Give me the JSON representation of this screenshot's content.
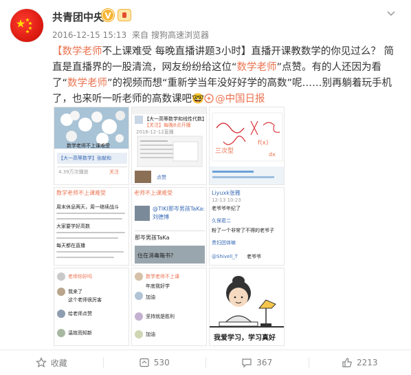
{
  "author": {
    "name": "共青团中央",
    "verified_mark": "V"
  },
  "meta": {
    "timestamp": "2016-12-15 15:13",
    "from": "来自",
    "source": "搜狗高速浏览器"
  },
  "post": {
    "p1_topic": "【数学老师",
    "p1_topic_rest": "不上课难受  每晚直播讲题3小时】",
    "p1_a": "直播开课教数学的你见过么？ 简直是直播界的一股清流，网友纷纷给这位“",
    "p1_hl1": "数学老师",
    "p1_b": "”点赞。有的人还因为看了“",
    "p1_hl2": "数学老师",
    "p1_c": "”的视频而想“重新学当年没好好学的高数”呢……别再躺着玩手机了，也来听一听老师的高数课吧",
    "emoji": "🤓",
    "link": "@中国日报"
  },
  "thumbs": {
    "t1": {
      "title": "数学老师不上课难受",
      "l1": "【大一高等数学】张献和",
      "l2": "4.39万次播放",
      "l3": "关注"
    },
    "t2": {
      "a": "【大一高等数学和线性代数】",
      "b": "【关注】每晚8点开播",
      "c": "2016-12-12直播",
      "d": "点赞"
    },
    "t3": {
      "a": "三次型",
      "b": "f(x)",
      "c": "dx"
    },
    "t4": {
      "title": "数学老师不上课难受",
      "a": "周末休息两天，周一继续战斗",
      "b": "大家要学好高数",
      "c": "每天都在直播"
    },
    "t5": {
      "title": "老师不上课难受",
      "a": "@TIKI那岑男孩TaKa: 住在酒",
      "b": "刘德博",
      "c": "那岑男孩TaKa",
      "d": "住在消毒箱书?"
    },
    "t6": {
      "title": "Liyuxk张雅",
      "a": "12-13 10:23",
      "b": "老爷爷年纪了",
      "c": "久保君二",
      "d": "粉了一个非常了不得的老爷子",
      "e": "贵妇团体嘛",
      "f": "@Shivell_T",
      "g": "老爷爷"
    },
    "t7": {
      "a": "老师你好吗",
      "b": "我来了",
      "c": "这个老师很厉害",
      "d": "给老师点赞",
      "e": "温故而知新"
    },
    "t8": {
      "a": "数学老师不上课",
      "b": "年底我好学",
      "c": "加油",
      "d": "坚持就是胜利",
      "e": "加油"
    },
    "t9": {
      "caption": "我爱学习，学习真好"
    }
  },
  "footer": {
    "collect": "收藏",
    "repost": "530",
    "comment": "367",
    "like": "2213"
  },
  "icons": [
    "caret-down-icon",
    "star-icon",
    "repost-icon",
    "comment-icon",
    "thumb-up-icon"
  ],
  "colors": {
    "accent": "#eb7350",
    "meta": "#808080",
    "text": "#333333"
  }
}
